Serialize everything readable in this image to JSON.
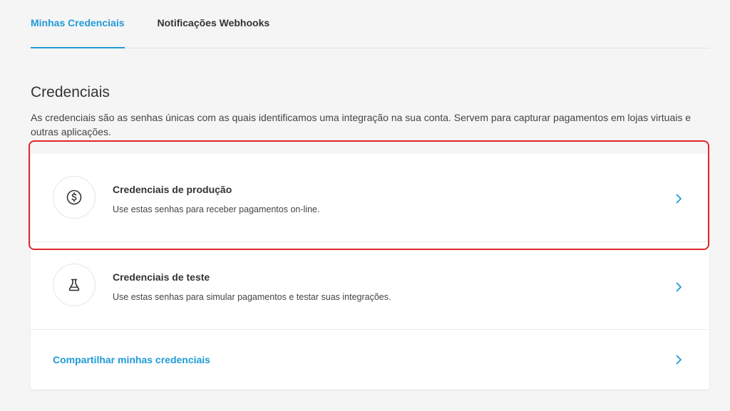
{
  "tabs": [
    {
      "label": "Minhas Credenciais",
      "active": true
    },
    {
      "label": "Notificações Webhooks",
      "active": false
    }
  ],
  "header": {
    "title": "Credenciais",
    "description": "As credenciais são as senhas únicas com as quais identificamos uma integração na sua conta. Servem para capturar pagamentos em lojas virtuais e outras aplicações."
  },
  "credentials": {
    "production": {
      "title": "Credenciais de produção",
      "subtitle": "Use estas senhas para receber pagamentos on-line.",
      "icon": "dollar-coin-icon"
    },
    "test": {
      "title": "Credenciais de teste",
      "subtitle": "Use estas senhas para simular pagamentos e testar suas integrações.",
      "icon": "flask-icon"
    },
    "share": {
      "label": "Compartilhar minhas credenciais"
    }
  },
  "colors": {
    "accent": "#1f9bd6",
    "highlight": "#e0252b",
    "background": "#f5f5f6"
  }
}
